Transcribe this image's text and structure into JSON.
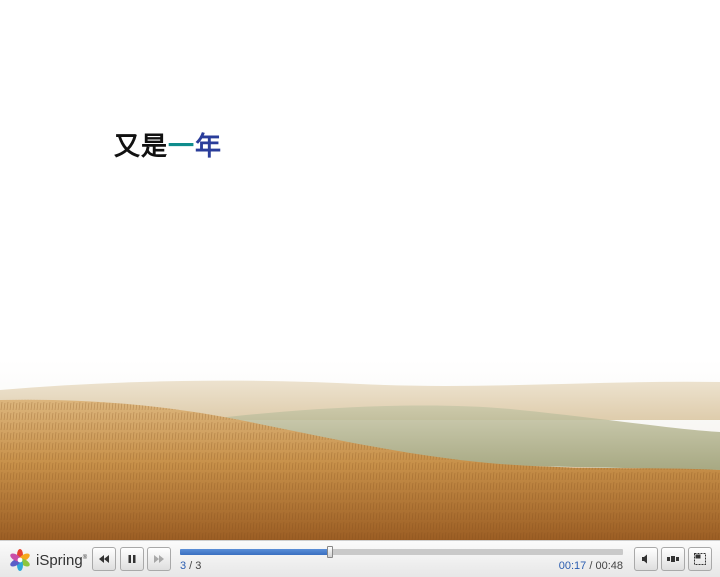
{
  "slide": {
    "title_parts": [
      {
        "text": "又是",
        "color": "#111111"
      },
      {
        "text": "一",
        "color": "#0e8c8c"
      },
      {
        "text": "年",
        "color": "#2a3d9a"
      }
    ],
    "background": "wheat-field-image"
  },
  "player": {
    "brand": "iSpring",
    "brand_mark": "®",
    "controls": {
      "rewind_icon": "rewind-icon",
      "pause_icon": "pause-icon",
      "forward_icon": "fast-forward-icon",
      "volume_icon": "volume-icon",
      "layout_icon": "layout-icon",
      "fullscreen_icon": "fullscreen-icon"
    },
    "progress_fraction": 0.339,
    "slide_current": "3",
    "slide_separator": " / ",
    "slide_total": "3",
    "time_current": "00:17",
    "time_separator": " / ",
    "time_total": "00:48",
    "accent_color": "#2a5db0"
  }
}
